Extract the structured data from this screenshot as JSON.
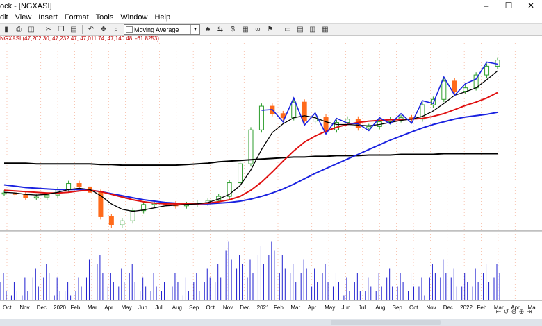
{
  "window": {
    "title": "ock - [NGXASI]"
  },
  "menu": [
    "dit",
    "View",
    "Insert",
    "Format",
    "Tools",
    "Window",
    "Help"
  ],
  "toolbar": {
    "indicator_select": "Moving Average",
    "icons": [
      "save-icon",
      "print-icon",
      "print-preview-icon",
      "cut-icon",
      "copy-icon",
      "paste-icon",
      "undo-icon",
      "crosshair-icon",
      "zoom-icon",
      "indicator-icon",
      "tree-icon",
      "dollar-icon",
      "split-icon",
      "binoculars-icon",
      "flag-icon",
      "window-icon",
      "tile-horizontal-icon",
      "tile-vertical-icon",
      "grid-icon"
    ]
  },
  "quote": {
    "symbol": "NGXASI",
    "values": "(47,202.30, 47,232.47, 47,011.74, 47,140.48, -61.8253)"
  },
  "window_buttons": [
    "–",
    "☐",
    "✕"
  ],
  "chart_data": {
    "type": "line",
    "x_axis_labels": [
      "Oct",
      "Nov",
      "Dec",
      "2020",
      "Feb",
      "Mar",
      "Apr",
      "May",
      "Jun",
      "Jul",
      "Aug",
      "Sep",
      "Oct",
      "Nov",
      "Dec",
      "2021",
      "Feb",
      "Mar",
      "Apr",
      "May",
      "Jun",
      "Jul",
      "Aug",
      "Sep",
      "Oct",
      "Nov",
      "Dec",
      "2022",
      "Feb",
      "Mar",
      "Apr",
      "Ma"
    ],
    "price_close": [
      27.5,
      27.3,
      26.8,
      26.9,
      27.2,
      28.0,
      28.9,
      28.4,
      27.6,
      24.0,
      22.8,
      23.4,
      24.9,
      25.8,
      26.0,
      25.9,
      25.6,
      25.8,
      26.0,
      26.4,
      27.0,
      29.0,
      31.8,
      36.8,
      40.3,
      39.2,
      38.6,
      40.9,
      38.1,
      38.7,
      36.8,
      37.9,
      38.4,
      37.1,
      37.3,
      38.0,
      38.3,
      38.6,
      38.4,
      40.5,
      41.3,
      44.0,
      42.5,
      43.0,
      44.9,
      46.2,
      47.1
    ],
    "ma_black": [
      27.6,
      27.5,
      27.3,
      27.2,
      27.3,
      27.6,
      28.0,
      28.2,
      28.0,
      27.1,
      25.9,
      25.1,
      24.8,
      25.0,
      25.3,
      25.6,
      25.7,
      25.8,
      25.9,
      26.1,
      26.6,
      27.3,
      28.6,
      30.9,
      33.9,
      36.4,
      37.7,
      38.6,
      38.9,
      38.6,
      38.0,
      37.6,
      37.6,
      37.5,
      37.4,
      37.6,
      37.9,
      38.2,
      38.4,
      38.8,
      39.6,
      40.7,
      41.9,
      42.4,
      43.0,
      44.2,
      45.5
    ],
    "ma_red": [
      27.9,
      27.8,
      27.7,
      27.6,
      27.5,
      27.5,
      27.6,
      27.8,
      27.9,
      27.7,
      27.3,
      26.9,
      26.5,
      26.2,
      26.0,
      25.9,
      25.9,
      25.9,
      25.9,
      26.0,
      26.2,
      26.5,
      27.0,
      27.9,
      29.1,
      30.6,
      32.2,
      33.7,
      35.0,
      35.9,
      36.6,
      37.2,
      37.6,
      37.9,
      38.1,
      38.2,
      38.3,
      38.3,
      38.4,
      38.5,
      38.8,
      39.2,
      39.8,
      40.4,
      40.9,
      41.5,
      42.3
    ],
    "ma_blue": [
      28.7,
      28.5,
      28.3,
      28.2,
      28.1,
      28.0,
      28.0,
      28.0,
      27.9,
      27.7,
      27.4,
      27.1,
      26.8,
      26.5,
      26.3,
      26.1,
      26.0,
      25.9,
      25.9,
      25.9,
      26.0,
      26.1,
      26.3,
      26.6,
      27.0,
      27.5,
      28.1,
      28.8,
      29.6,
      30.4,
      31.1,
      31.8,
      32.5,
      33.2,
      33.9,
      34.6,
      35.3,
      35.9,
      36.5,
      37.1,
      37.6,
      38.0,
      38.4,
      38.7,
      38.9,
      39.1,
      39.4
    ],
    "ma_200": [
      31.9,
      31.9,
      31.9,
      31.8,
      31.8,
      31.8,
      31.8,
      31.8,
      31.8,
      31.7,
      31.7,
      31.6,
      31.6,
      31.6,
      31.6,
      31.6,
      31.6,
      31.7,
      31.8,
      31.9,
      32.1,
      32.2,
      32.3,
      32.4,
      32.5,
      32.6,
      32.7,
      32.8,
      32.8,
      32.9,
      32.9,
      33.0,
      33.0,
      33.0,
      33.1,
      33.1,
      33.1,
      33.2,
      33.2,
      33.2,
      33.2,
      33.3,
      33.3,
      33.3,
      33.3,
      33.3,
      33.3
    ],
    "volume": [
      6,
      4,
      5,
      7,
      8,
      5,
      4,
      5,
      9,
      10,
      6,
      7,
      8,
      5,
      6,
      4,
      6,
      5,
      6,
      7,
      8,
      13,
      10,
      9,
      12,
      13,
      10,
      8,
      9,
      7,
      8,
      6,
      5,
      6,
      5,
      6,
      7,
      6,
      6,
      5,
      8,
      9,
      7,
      6,
      7,
      8,
      8
    ],
    "colors": {
      "price_up": "#2e9e2e",
      "price_down": "#ff6a1a",
      "ma_black": "#000000",
      "ma_red": "#e01010",
      "ma_blue": "#1a22e0",
      "ma_200": "#000000",
      "zigzag": "#1a22e0",
      "volume": "#2020d0",
      "grid": "#f4a080"
    }
  }
}
